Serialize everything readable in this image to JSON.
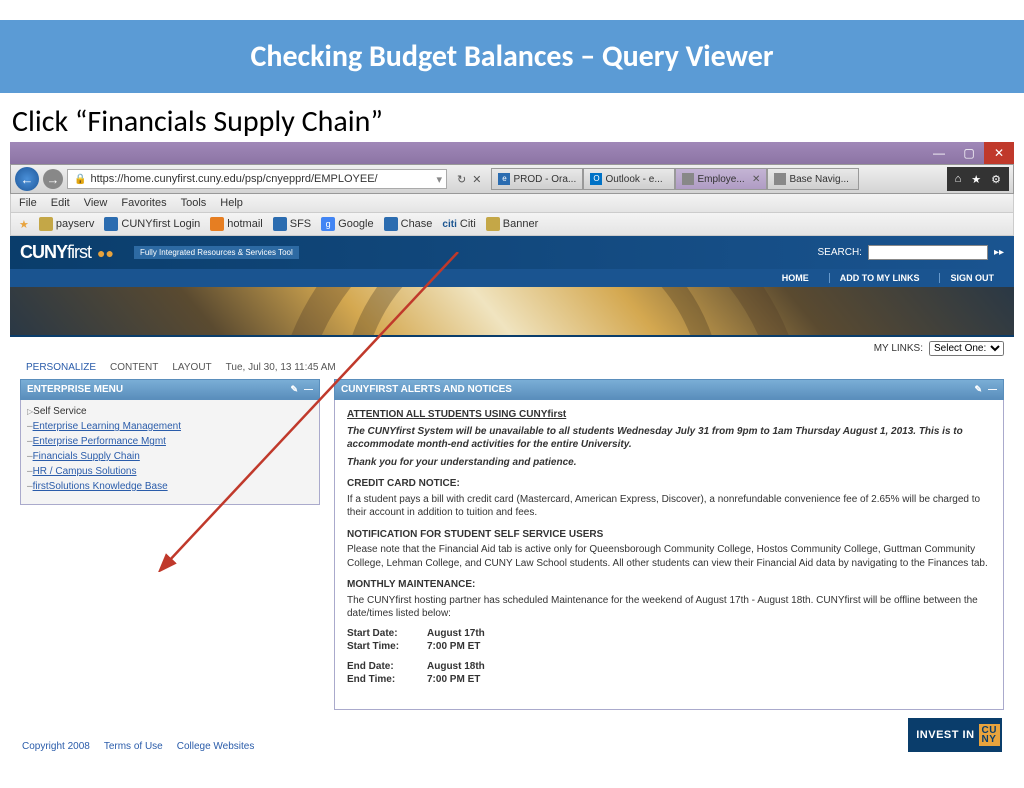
{
  "slide": {
    "title": "Checking Budget Balances – Query Viewer",
    "instruction": "Click “Financials Supply Chain”"
  },
  "browser": {
    "url": "https://home.cunyfirst.cuny.edu/psp/cnyepprd/EMPLOYEE/",
    "menus": [
      "File",
      "Edit",
      "View",
      "Favorites",
      "Tools",
      "Help"
    ],
    "bookmarks": [
      "payserv",
      "CUNYfirst Login",
      "hotmail",
      "SFS",
      "Google",
      "Chase",
      "Citi",
      "Banner"
    ],
    "tabs": [
      {
        "label": "PROD - Ora...",
        "icon": "e"
      },
      {
        "label": "Outlook - e...",
        "icon": "O"
      },
      {
        "label": "Employe...",
        "icon": " ",
        "active": true
      },
      {
        "label": "Base Navig...",
        "icon": " "
      }
    ]
  },
  "cuny": {
    "logo1": "CUNY",
    "logo2": "first",
    "tagline": "Fully Integrated Resources & Services Tool",
    "search_label": "SEARCH:",
    "nav": [
      "HOME",
      "ADD TO MY LINKS",
      "SIGN OUT"
    ],
    "mylinks_label": "MY LINKS:",
    "mylinks_value": "Select One:",
    "tabrow": {
      "personalize": "PERSONALIZE",
      "content": "CONTENT",
      "layout": "LAYOUT",
      "date": "Tue, Jul 30, 13 11:45 AM"
    }
  },
  "menu": {
    "title": "ENTERPRISE MENU",
    "items": [
      "Self Service",
      "Enterprise Learning Management",
      "Enterprise Performance Mgmt",
      "Financials Supply Chain",
      "HR / Campus Solutions",
      "firstSolutions Knowledge Base"
    ]
  },
  "notices": {
    "title": "CUNYFIRST ALERTS AND NOTICES",
    "heading": "ATTENTION ALL STUDENTS USING CUNYfirst",
    "p1": "The CUNYfirst System will be unavailable to all students Wednesday July 31 from 9pm to 1am Thursday August 1, 2013. This is to accommodate month-end activities for the entire University.",
    "p2": "Thank you for your understanding and patience.",
    "cc_title": "CREDIT CARD NOTICE:",
    "cc_body": "If a student pays a bill with credit card (Mastercard, American Express, Discover), a nonrefundable convenience fee of 2.65% will be charged to their account in addition to tuition and fees.",
    "ss_title": "NOTIFICATION FOR STUDENT SELF SERVICE USERS",
    "ss_body": "Please note that the Financial Aid tab is active only for Queensborough Community College, Hostos Community College, Guttman Community College, Lehman College, and CUNY Law School students. All other students can view their Financial Aid data by navigating to the Finances tab.",
    "mm_title": "MONTHLY MAINTENANCE:",
    "mm_body": "The CUNYfirst hosting partner has scheduled Maintenance for the weekend of August 17th - August 18th. CUNYfirst will be offline between the date/times listed below:",
    "dt": {
      "sd_l": "Start Date:",
      "sd_v": "August 17th",
      "st_l": "Start Time:",
      "st_v": "7:00 PM ET",
      "ed_l": "End Date:",
      "ed_v": "August 18th",
      "et_l": "End Time:",
      "et_v": "7:00 PM ET"
    }
  },
  "footer": {
    "links": [
      "Copyright 2008",
      "Terms of Use",
      "College Websites"
    ],
    "invest": "INVEST IN",
    "cu1": "CU",
    "cu2": "NY"
  }
}
